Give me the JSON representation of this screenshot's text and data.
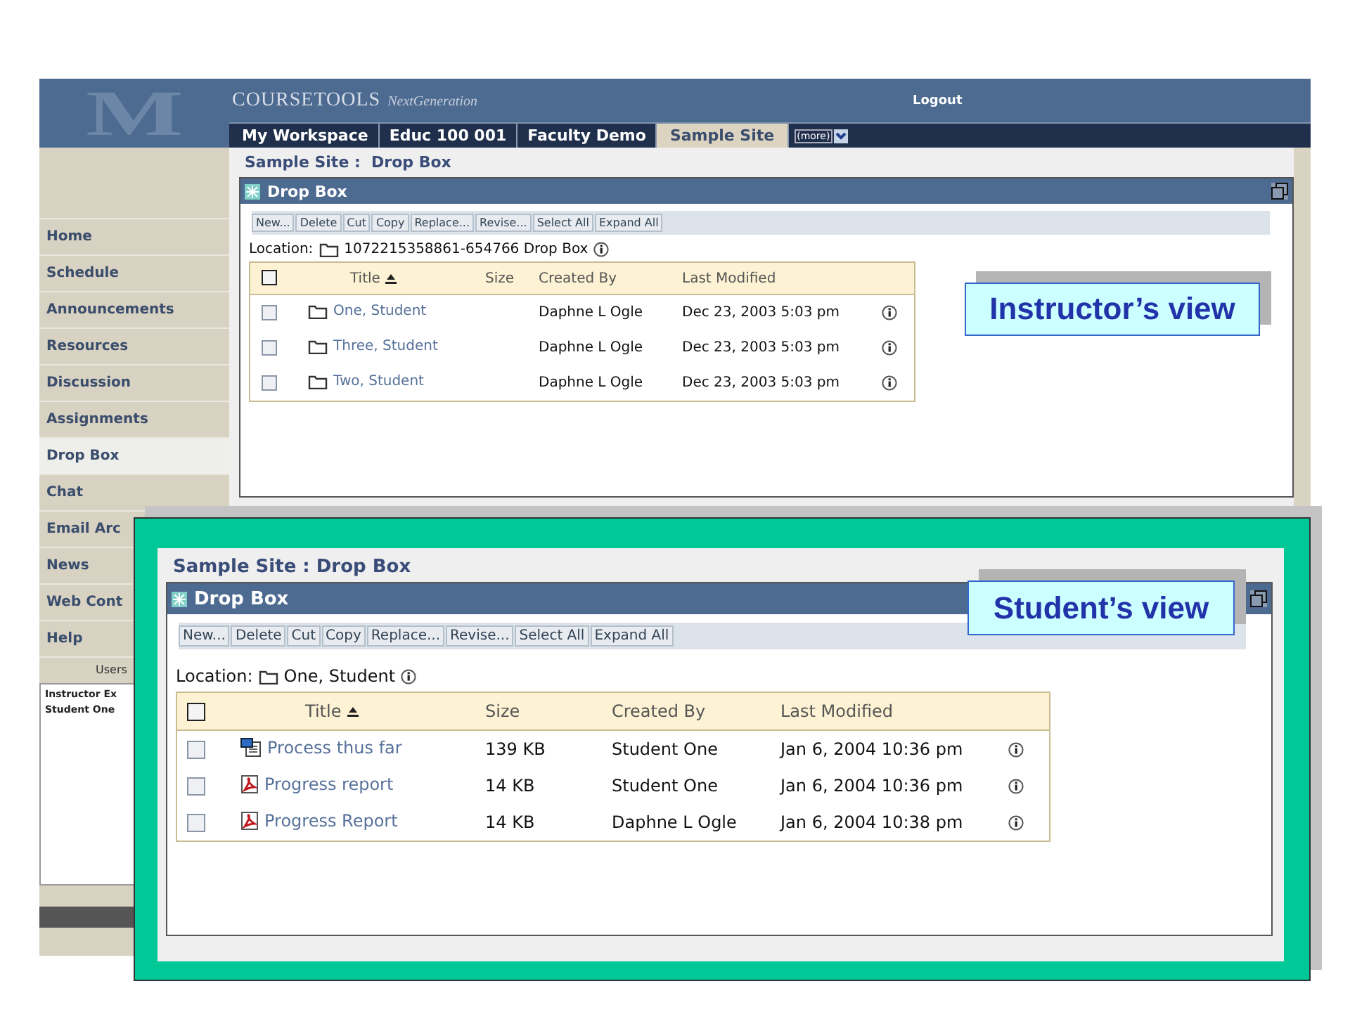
{
  "header": {
    "logo": "M",
    "brand": "COURSETOOLS",
    "tagline": "NextGeneration",
    "logout": "Logout"
  },
  "site_tabs": [
    {
      "label": "My Workspace",
      "selected": false
    },
    {
      "label": "Educ 100 001",
      "selected": false
    },
    {
      "label": "Faculty Demo",
      "selected": false
    },
    {
      "label": "Sample Site",
      "selected": true
    }
  ],
  "more_menu": "(more)",
  "sidebar": {
    "items": [
      {
        "label": "Home",
        "selected": false
      },
      {
        "label": "Schedule",
        "selected": false
      },
      {
        "label": "Announcements",
        "selected": false
      },
      {
        "label": "Resources",
        "selected": false
      },
      {
        "label": "Discussion",
        "selected": false
      },
      {
        "label": "Assignments",
        "selected": false
      },
      {
        "label": "Drop Box",
        "selected": true
      },
      {
        "label": "Chat",
        "selected": false
      },
      {
        "label": "Email Arc",
        "selected": false
      },
      {
        "label": "News",
        "selected": false
      },
      {
        "label": "Web Cont",
        "selected": false
      },
      {
        "label": "Help",
        "selected": false
      }
    ],
    "users_heading": "Users",
    "users": [
      "Instructor Ex",
      "Student One"
    ]
  },
  "views": [
    {
      "breadcrumb": "Sample Site :  Drop Box",
      "panel_title": "Drop Box",
      "toolbar": [
        "New...",
        "Delete",
        "Cut",
        "Copy",
        "Replace...",
        "Revise...",
        "Select All",
        "Expand All"
      ],
      "location_label": "Location:",
      "location": "1072215358861-654766 Drop Box",
      "select_all_checked": false,
      "columns": [
        "Title",
        "Size",
        "Created By",
        "Last Modified"
      ],
      "rows": [
        {
          "checked": false,
          "kind": "folder",
          "title": "One, Student",
          "size": "",
          "created_by": "Daphne L Ogle",
          "last_modified": "Dec 23, 2003 5:03 pm"
        },
        {
          "checked": false,
          "kind": "folder",
          "title": "Three, Student",
          "size": "",
          "created_by": "Daphne L Ogle",
          "last_modified": "Dec 23, 2003 5:03 pm"
        },
        {
          "checked": false,
          "kind": "folder",
          "title": "Two, Student",
          "size": "",
          "created_by": "Daphne L Ogle",
          "last_modified": "Dec 23, 2003 5:03 pm"
        }
      ],
      "callout": "Instructor’s view"
    },
    {
      "breadcrumb": "Sample Site : Drop Box",
      "panel_title": "Drop Box",
      "toolbar": [
        "New...",
        "Delete",
        "Cut",
        "Copy",
        "Replace...",
        "Revise...",
        "Select All",
        "Expand All"
      ],
      "location_label": "Location:",
      "location": "One, Student",
      "select_all_checked": false,
      "columns": [
        "Title",
        "Size",
        "Created By",
        "Last Modified"
      ],
      "rows": [
        {
          "checked": false,
          "kind": "word",
          "title": "Process thus far",
          "size": "139 KB",
          "created_by": "Student One",
          "last_modified": "Jan 6, 2004 10:36 pm"
        },
        {
          "checked": false,
          "kind": "pdf",
          "title": "Progress report",
          "size": "14 KB",
          "created_by": "Student One",
          "last_modified": "Jan 6, 2004 10:36 pm"
        },
        {
          "checked": false,
          "kind": "pdf",
          "title": "Progress Report",
          "size": "14 KB",
          "created_by": "Daphne L Ogle",
          "last_modified": "Jan 6, 2004 10:38 pm"
        }
      ],
      "callout": "Student’s view"
    }
  ]
}
